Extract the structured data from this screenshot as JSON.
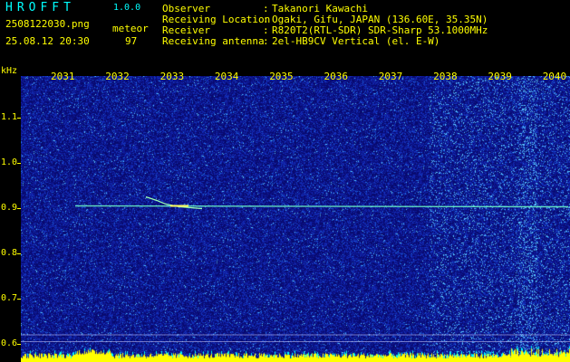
{
  "header": {
    "app_title": "HROFFT",
    "app_version": "1.0.0",
    "file_name": "2508122030.png",
    "mode_label": "meteor",
    "date_time": "25.08.12 20:30",
    "count_value": "97"
  },
  "info": [
    {
      "label": "Observer",
      "sep": ":",
      "value": "Takanori Kawachi"
    },
    {
      "label": "Receiving Location",
      "sep": ":",
      "value": "Ogaki, Gifu, JAPAN (136.60E, 35.35N)"
    },
    {
      "label": "Receiver",
      "sep": ":",
      "value": "R820T2(RTL-SDR) SDR-Sharp 53.1000MHz"
    },
    {
      "label": "Receiving antenna",
      "sep": ":",
      "value": "2el-HB9CV Vertical (el. E-W)"
    }
  ],
  "spectrogram": {
    "unit_label": "kHz",
    "time_labels": [
      "2031",
      "2032",
      "2033",
      "2034",
      "2035",
      "2036",
      "2037",
      "2038",
      "2039",
      "2040"
    ],
    "freq_labels": [
      "1.1",
      "1.0",
      "0.9",
      "0.8",
      "0.7",
      "0.6"
    ],
    "freq_values": [
      1.1,
      1.0,
      0.9,
      0.8,
      0.7,
      0.6
    ],
    "signal_freq_khz": 0.905,
    "colors": {
      "background": "#000000",
      "labels": "#ffff00",
      "title": "#00ffff",
      "noise_base": "#14148c",
      "signal": "#80ffd0",
      "bottom_band": "#ffff00"
    }
  }
}
